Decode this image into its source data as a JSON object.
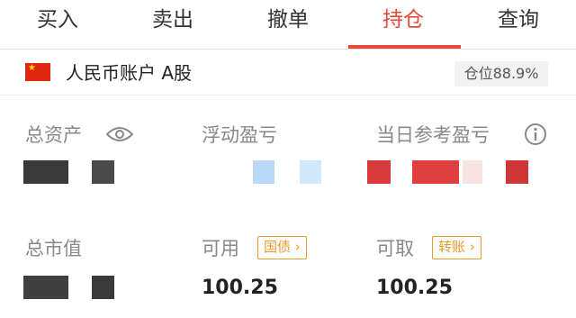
{
  "tabs": [
    {
      "label": "买入"
    },
    {
      "label": "卖出"
    },
    {
      "label": "撤单"
    },
    {
      "label": "持仓"
    },
    {
      "label": "查询"
    }
  ],
  "active_tab": "持仓",
  "account": {
    "name": "人民币账户 A股",
    "position_ratio": "仓位88.9%"
  },
  "summary": {
    "total_assets_label": "总资产",
    "floating_pl_label": "浮动盈亏",
    "daily_pl_label": "当日参考盈亏",
    "market_value_label": "总市值",
    "available_label": "可用",
    "available_tag": "国债",
    "available_value": "100.25",
    "withdrawable_label": "可取",
    "withdrawable_tag": "转账",
    "withdrawable_value": "100.25"
  },
  "colors": {
    "accent": "#e8473a",
    "tag": "#e59a2e"
  }
}
